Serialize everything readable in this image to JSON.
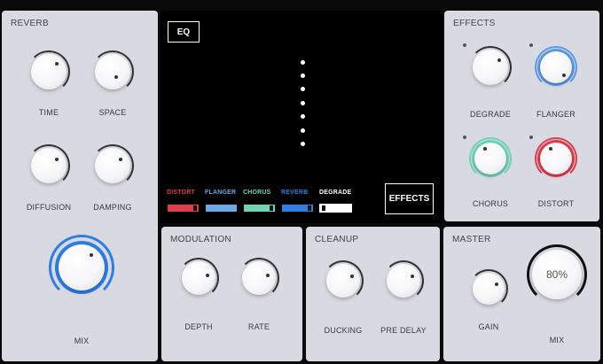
{
  "reverb": {
    "title": "REVERB",
    "knobs": {
      "time": "TIME",
      "space": "SPACE",
      "diffusion": "DIFFUSION",
      "damping": "DAMPING",
      "mix": "MIX"
    }
  },
  "center": {
    "eq_label": "EQ",
    "effects_button": "EFFECTS",
    "fx_chain": [
      {
        "label": "DISTORT",
        "color": "#e23b4a"
      },
      {
        "label": "FLANGER",
        "color": "#6aa8e8"
      },
      {
        "label": "CHORUS",
        "color": "#6fd3b6"
      },
      {
        "label": "REVERB",
        "color": "#2d7fe6"
      },
      {
        "label": "DEGRADE",
        "color": "#ffffff"
      }
    ]
  },
  "effects": {
    "title": "EFFECTS",
    "knobs": {
      "degrade": "DEGRADE",
      "flanger": "FLANGER",
      "chorus": "CHORUS",
      "distort": "DISTORT"
    },
    "colors": {
      "flanger": "#5b9be6",
      "chorus": "#6fd3b6",
      "distort": "#e23b4a"
    }
  },
  "modulation": {
    "title": "MODULATION",
    "knobs": {
      "depth": "DEPTH",
      "rate": "RATE"
    }
  },
  "cleanup": {
    "title": "CLEANUP",
    "knobs": {
      "ducking": "DUCKING",
      "pre_delay": "PRE DELAY"
    }
  },
  "master": {
    "title": "MASTER",
    "knobs": {
      "gain": "GAIN",
      "mix": "MIX"
    },
    "mix_value": "80%"
  },
  "accent": "#2d7fe6"
}
